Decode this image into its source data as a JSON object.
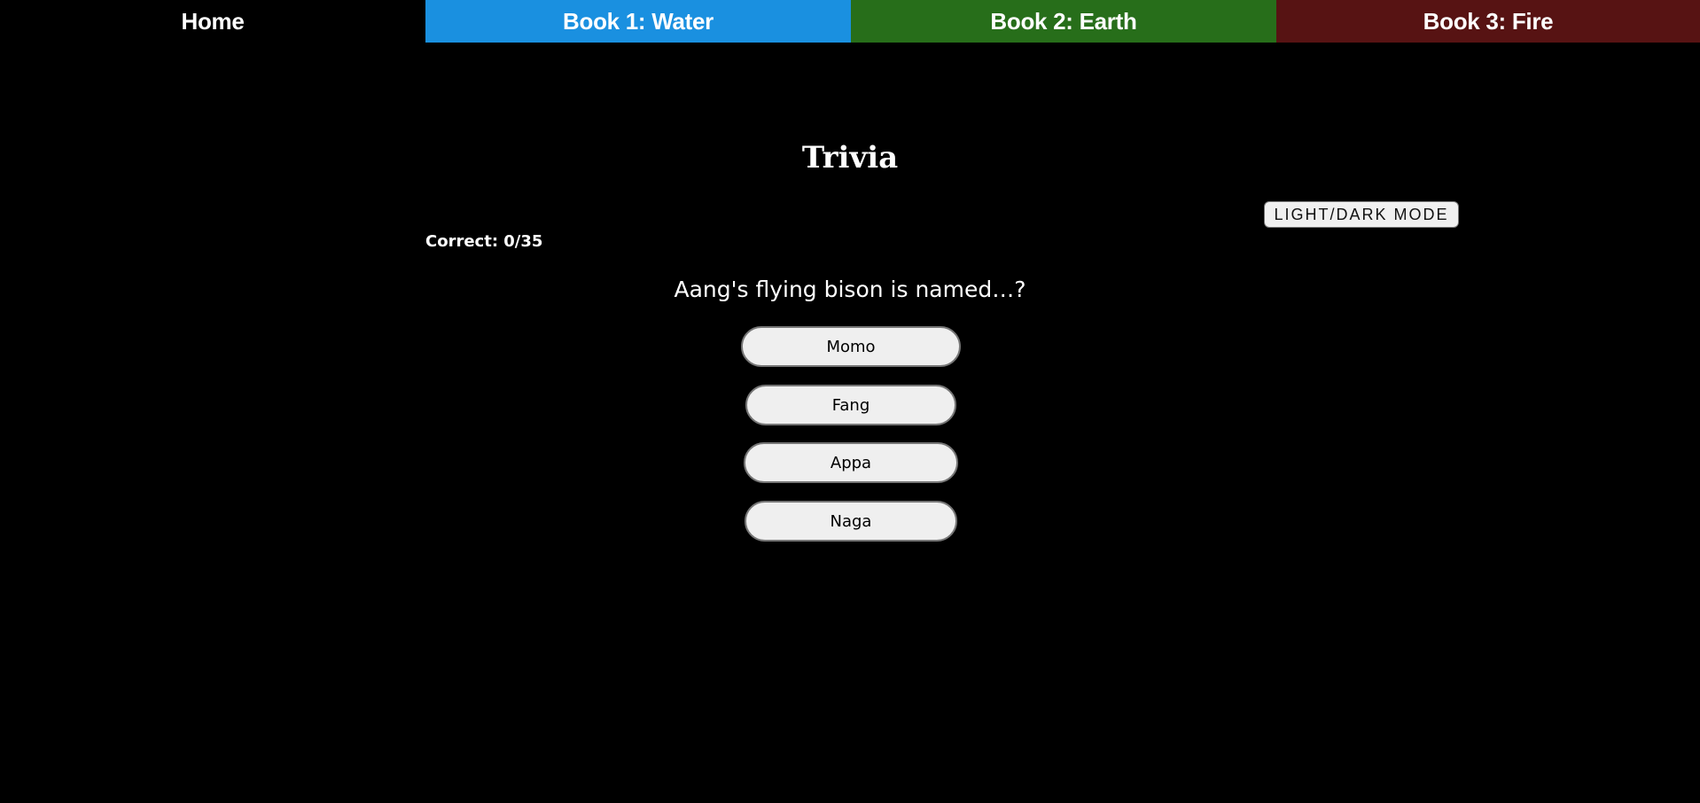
{
  "nav": {
    "tabs": [
      {
        "label": "Home",
        "color": "#000000"
      },
      {
        "label": "Book 1: Water",
        "color": "#1a90e0"
      },
      {
        "label": "Book 2: Earth",
        "color": "#276e1a"
      },
      {
        "label": "Book 3: Fire",
        "color": "#571313"
      }
    ]
  },
  "page": {
    "title": "Trivia",
    "mode_button_label": "LIGHT/DARK MODE",
    "score": "Correct: 0/35"
  },
  "quiz": {
    "question": "Aang's flying bison is named…?",
    "answers": [
      "Momo",
      "Fang",
      "Appa",
      "Naga"
    ]
  },
  "colors": {
    "background": "#000000",
    "text": "#ffffff",
    "button_bg": "#efefef"
  }
}
